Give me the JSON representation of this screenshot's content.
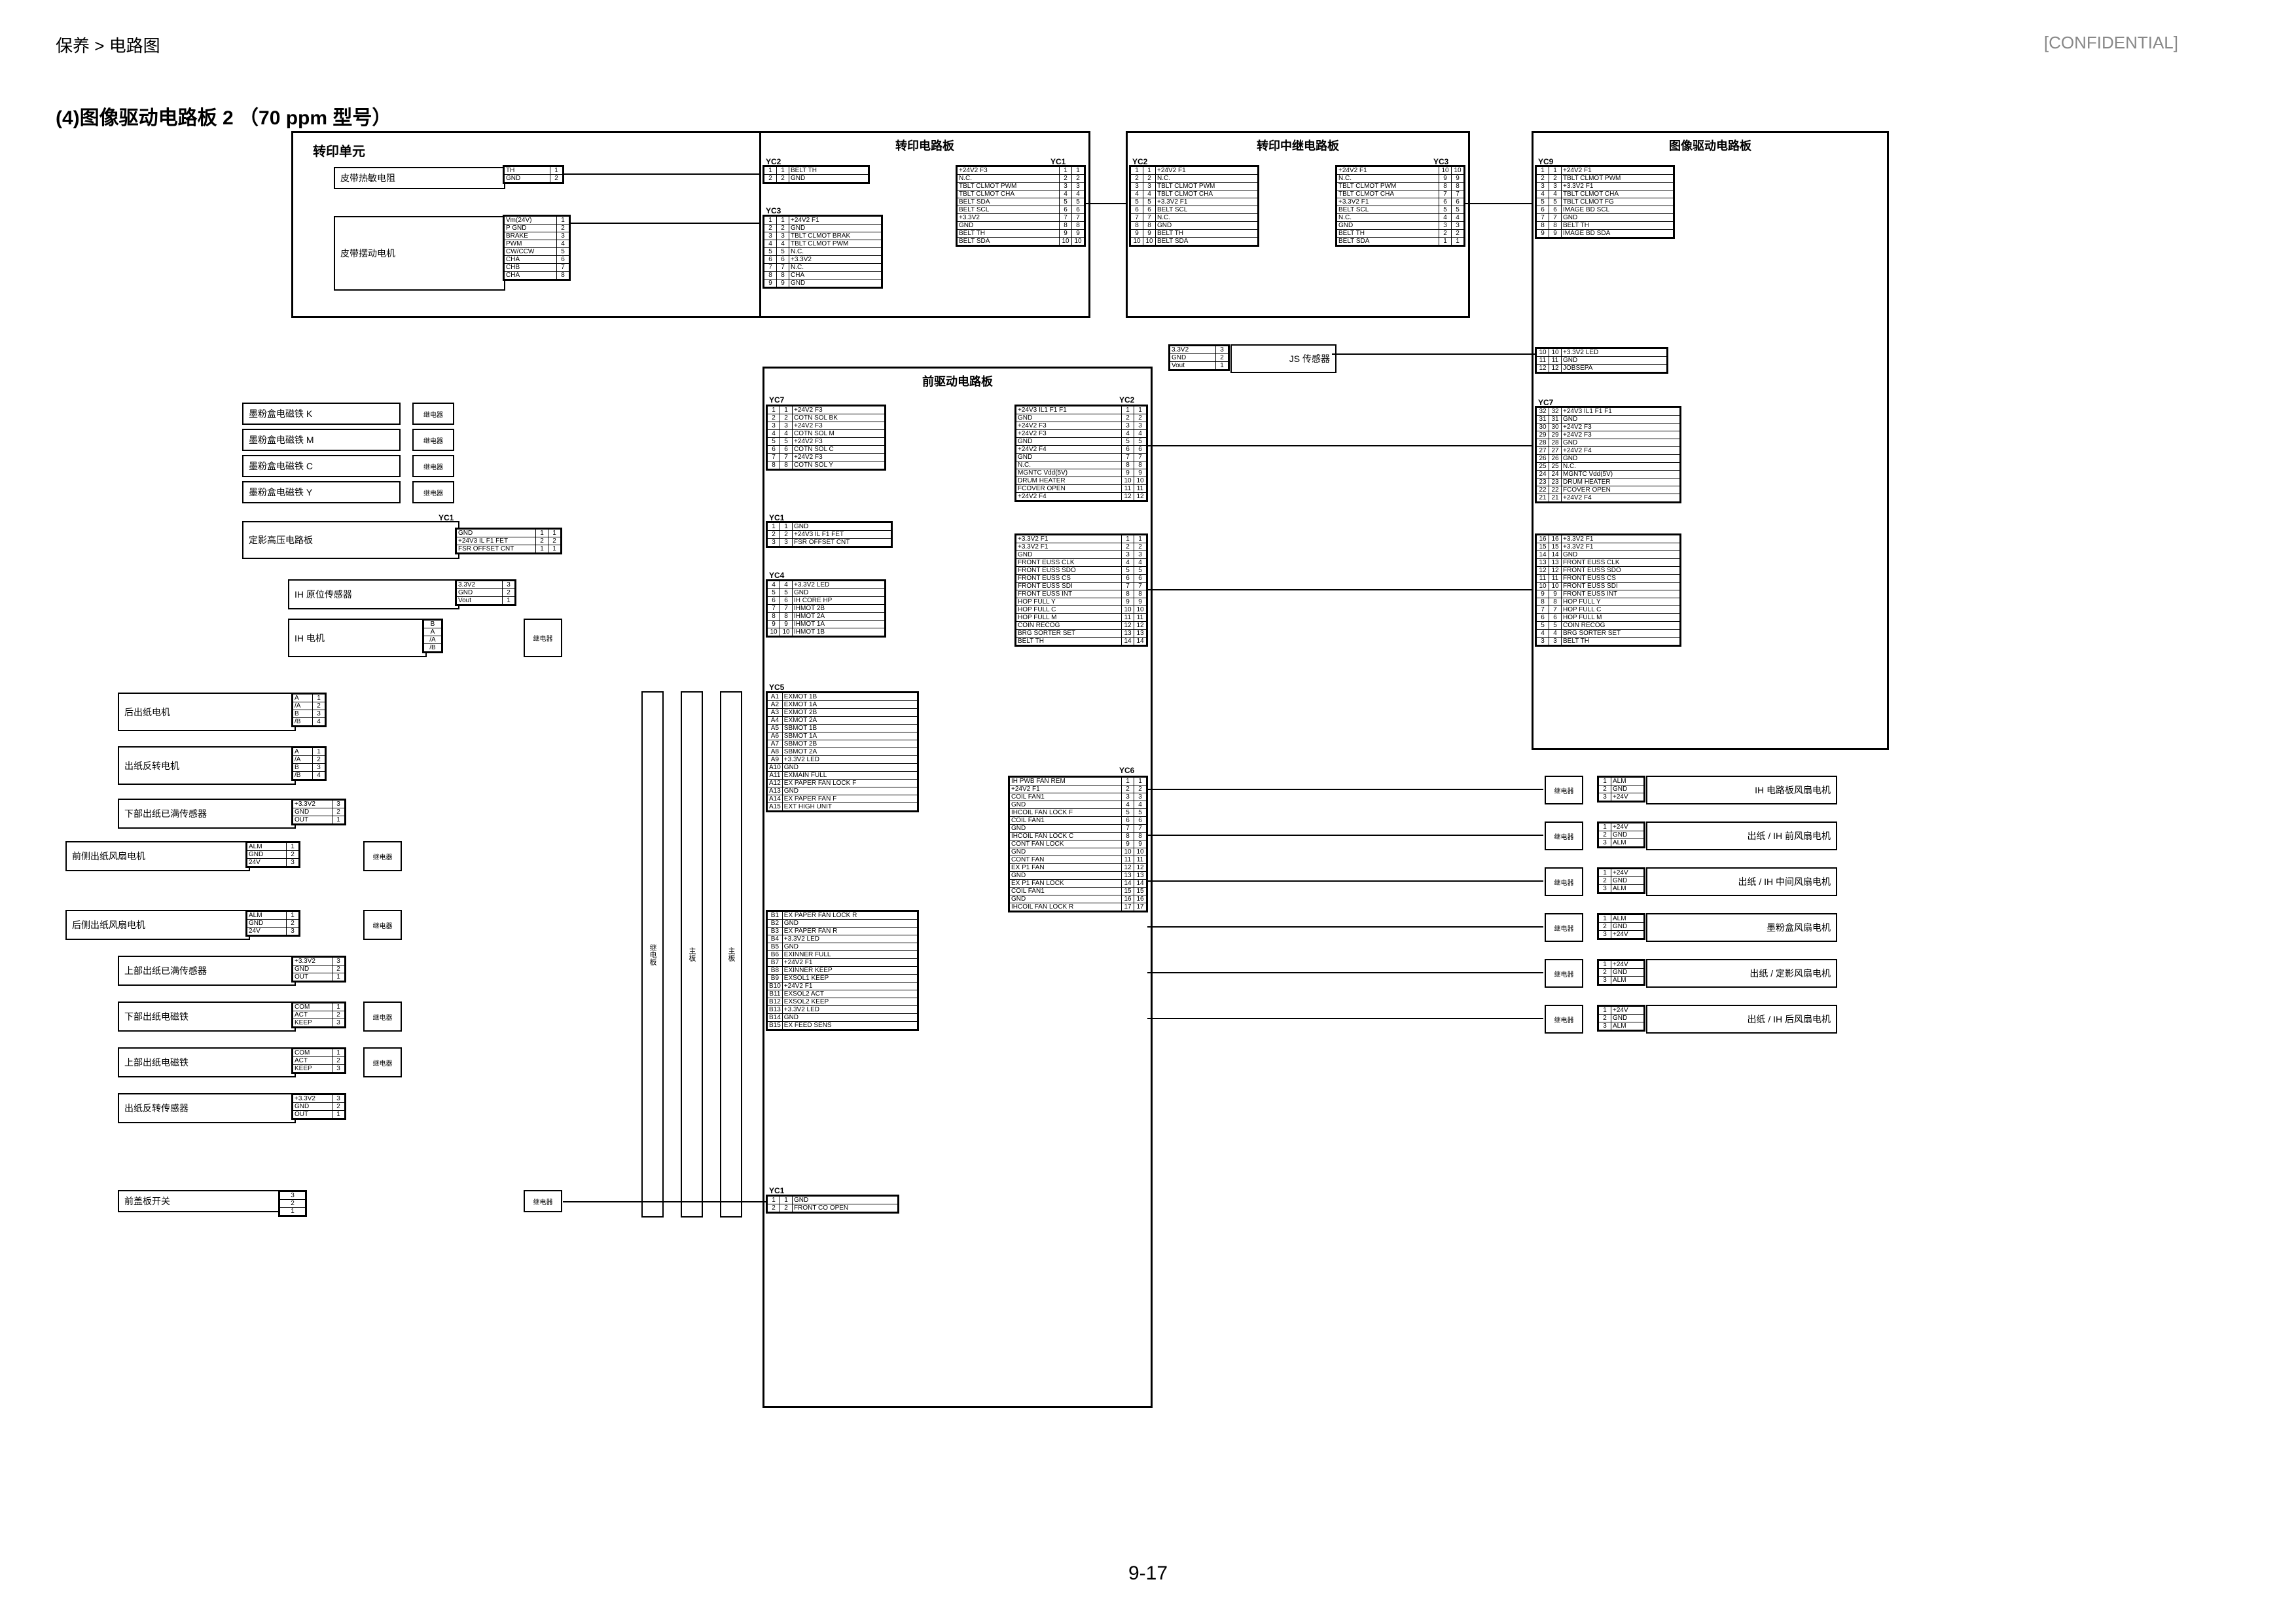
{
  "header": {
    "breadcrumb": "保养 > 电路图",
    "confidential": "[CONFIDENTIAL]"
  },
  "title": "(4)图像驱动电路板 2 （70 ppm 型号）",
  "page_number": "9-17",
  "units": {
    "transfer_unit": {
      "title": "转印单元"
    }
  },
  "pwbs": {
    "transfer": {
      "title": "转印电路板"
    },
    "transfer_relay": {
      "title": "转印中继电路板"
    },
    "engine": {
      "title": "图像驱动电路板"
    },
    "front_drive": {
      "title": "前驱动电路板"
    }
  },
  "components_left": [
    {
      "id": "belt-therm",
      "label": "皮带热敏电阻"
    },
    {
      "id": "belt-motor",
      "label": "皮带摆动电机"
    },
    {
      "id": "sol-k",
      "label": "墨粉盒电磁铁 K"
    },
    {
      "id": "sol-m",
      "label": "墨粉盒电磁铁 M"
    },
    {
      "id": "sol-c",
      "label": "墨粉盒电磁铁 C"
    },
    {
      "id": "sol-y",
      "label": "墨粉盒电磁铁 Y"
    },
    {
      "id": "fuser-hv-pwb",
      "label": "定影高压电路板"
    },
    {
      "id": "ih-hp-sens",
      "label": "IH 原位传感器"
    },
    {
      "id": "ih-motor",
      "label": "IH 电机"
    },
    {
      "id": "rear-exit",
      "label": "后出纸电机"
    },
    {
      "id": "exit-rev",
      "label": "出纸反转电机"
    },
    {
      "id": "lower-full",
      "label": "下部出纸已满传感器"
    },
    {
      "id": "front-fan",
      "label": "前侧出纸风扇电机"
    },
    {
      "id": "rear-fan",
      "label": "后侧出纸风扇电机"
    },
    {
      "id": "upper-full",
      "label": "上部出纸已满传感器"
    },
    {
      "id": "lower-sol",
      "label": "下部出纸电磁铁"
    },
    {
      "id": "upper-sol",
      "label": "上部出纸电磁铁"
    },
    {
      "id": "exit-rev-s",
      "label": "出纸反转传感器"
    },
    {
      "id": "front-sw",
      "label": "前盖板开关"
    }
  ],
  "components_right": [
    {
      "id": "js-sensor",
      "label": "JS 传感器"
    },
    {
      "id": "ih-pwb-fan",
      "label": "IH 电路板风扇电机"
    },
    {
      "id": "exit-ih-f",
      "label": "出纸 / IH 前风扇电机"
    },
    {
      "id": "exit-ih-m",
      "label": "出纸 / IH 中间风扇电机"
    },
    {
      "id": "toner-fan",
      "label": "墨粉盒风扇电机"
    },
    {
      "id": "exit-fus-fan",
      "label": "出纸 / 定影风扇电机"
    },
    {
      "id": "exit-ih-r",
      "label": "出纸 / IH 后风扇电机"
    }
  ],
  "relays": {
    "small": "继电器",
    "relay_b": "继电板",
    "main": "主板"
  },
  "pins_belt_therm": [
    {
      "n": "1",
      "sig": "TH"
    },
    {
      "n": "2",
      "sig": "GND"
    }
  ],
  "pins_belt_motor": [
    {
      "n": "1",
      "sig": "Vm(24V)"
    },
    {
      "n": "2",
      "sig": "P GND"
    },
    {
      "n": "3",
      "sig": "BRAKE"
    },
    {
      "n": "4",
      "sig": "PWM"
    },
    {
      "n": "5",
      "sig": "CW/CCW"
    },
    {
      "n": "6",
      "sig": "CHA"
    },
    {
      "n": "7",
      "sig": "CHB"
    },
    {
      "n": "8",
      "sig": "CHA"
    }
  ],
  "pins_yc2": [
    {
      "n": "1",
      "sig": "BELT TH"
    },
    {
      "n": "2",
      "sig": "GND"
    }
  ],
  "pins_yc3": [
    {
      "n": "1",
      "sig": "+24V2  F1"
    },
    {
      "n": "2",
      "sig": "GND"
    },
    {
      "n": "3",
      "sig": "TBLT CLMOT BRAK"
    },
    {
      "n": "4",
      "sig": "TBLT CLMOT PWM"
    },
    {
      "n": "5",
      "sig": "N.C."
    },
    {
      "n": "6",
      "sig": "+3.3V2"
    },
    {
      "n": "7",
      "sig": "N.C."
    },
    {
      "n": "8",
      "sig": "CHA"
    },
    {
      "n": "9",
      "sig": "GND"
    }
  ],
  "pins_yc1_transfer": [
    {
      "n": "1",
      "sig": "+24V2  F3"
    },
    {
      "n": "2",
      "sig": "N.C."
    },
    {
      "n": "3",
      "sig": "TBLT CLMOT PWM"
    },
    {
      "n": "4",
      "sig": "TBLT CLMOT CHA"
    },
    {
      "n": "5",
      "sig": "BELT SDA"
    },
    {
      "n": "6",
      "sig": "BELT SCL"
    },
    {
      "n": "7",
      "sig": "+3.3V2"
    },
    {
      "n": "8",
      "sig": "GND"
    },
    {
      "n": "9",
      "sig": "BELT TH"
    },
    {
      "n": "10",
      "sig": "BELT SDA"
    }
  ],
  "pins_yc2_relay": [
    {
      "n": "1",
      "sig": "+24V2  F1"
    },
    {
      "n": "2",
      "sig": "N.C."
    },
    {
      "n": "3",
      "sig": "TBLT CLMOT PWM"
    },
    {
      "n": "4",
      "sig": "TBLT CLMOT CHA"
    },
    {
      "n": "5",
      "sig": "+3.3V2  F1"
    },
    {
      "n": "6",
      "sig": "BELT SCL"
    },
    {
      "n": "7",
      "sig": "N.C."
    },
    {
      "n": "8",
      "sig": "GND"
    },
    {
      "n": "9",
      "sig": "BELT TH"
    },
    {
      "n": "10",
      "sig": "BELT SDA"
    }
  ],
  "pins_yc3_relay": [
    {
      "n": "10",
      "sig": "+24V2  F1"
    },
    {
      "n": "9",
      "sig": "N.C."
    },
    {
      "n": "8",
      "sig": "TBLT CLMOT PWM"
    },
    {
      "n": "7",
      "sig": "TBLT CLMOT CHA"
    },
    {
      "n": "6",
      "sig": "+3.3V2  F1"
    },
    {
      "n": "5",
      "sig": "BELT SCL"
    },
    {
      "n": "4",
      "sig": "N.C."
    },
    {
      "n": "3",
      "sig": "GND"
    },
    {
      "n": "2",
      "sig": "BELT TH"
    },
    {
      "n": "1",
      "sig": "BELT SDA"
    }
  ],
  "pins_yc9_engine": [
    {
      "n": "1",
      "sig": "+24V2  F1"
    },
    {
      "n": "2",
      "sig": "TBLT CLMOT PWM"
    },
    {
      "n": "3",
      "sig": "+3.3V2  F1"
    },
    {
      "n": "4",
      "sig": "TBLT CLMOT CHA"
    },
    {
      "n": "5",
      "sig": "TBLT CLMOT FG"
    },
    {
      "n": "6",
      "sig": "IMAGE BD SCL"
    },
    {
      "n": "7",
      "sig": "GND"
    },
    {
      "n": "8",
      "sig": "BELT TH"
    },
    {
      "n": "9",
      "sig": "IMAGE BD SDA"
    }
  ],
  "pins_js": [
    {
      "n": "3",
      "sig": "3.3V2"
    },
    {
      "n": "2",
      "sig": "GND"
    },
    {
      "n": "1",
      "sig": "Vout"
    }
  ],
  "pins_engine_js": [
    {
      "n": "10",
      "sig": "+3.3V2 LED"
    },
    {
      "n": "11",
      "sig": "GND"
    },
    {
      "n": "12",
      "sig": "JOBSEPA"
    }
  ],
  "pins_yc7_fd": [
    {
      "n": "1",
      "sig": "+24V2  F3"
    },
    {
      "n": "2",
      "sig": "COTN SOL BK"
    },
    {
      "n": "3",
      "sig": "+24V2  F3"
    },
    {
      "n": "4",
      "sig": "COTN SOL M"
    },
    {
      "n": "5",
      "sig": "+24V2  F3"
    },
    {
      "n": "6",
      "sig": "COTN SOL C"
    },
    {
      "n": "7",
      "sig": "+24V2  F3"
    },
    {
      "n": "8",
      "sig": "COTN SOL Y"
    }
  ],
  "pins_yc2_fd": [
    {
      "n": "1",
      "sig": "+24V3 IL1 F1 F1"
    },
    {
      "n": "2",
      "sig": "GND"
    },
    {
      "n": "3",
      "sig": "+24V2  F3"
    },
    {
      "n": "4",
      "sig": "+24V2  F3"
    },
    {
      "n": "5",
      "sig": "GND"
    },
    {
      "n": "6",
      "sig": "+24V2  F4"
    },
    {
      "n": "7",
      "sig": "GND"
    },
    {
      "n": "8",
      "sig": "N.C."
    },
    {
      "n": "9",
      "sig": "MGNTC Vdd(5V)"
    },
    {
      "n": "10",
      "sig": "DRUM HEATER"
    },
    {
      "n": "11",
      "sig": "FCOVER OPEN"
    },
    {
      "n": "12",
      "sig": "+24V2  F4"
    }
  ],
  "pins_yc7_engine": [
    {
      "n": "32",
      "sig": "+24V3 IL1 F1 F1"
    },
    {
      "n": "31",
      "sig": "GND"
    },
    {
      "n": "30",
      "sig": "+24V2  F3"
    },
    {
      "n": "29",
      "sig": "+24V2  F3"
    },
    {
      "n": "28",
      "sig": "GND"
    },
    {
      "n": "27",
      "sig": "+24V2  F4"
    },
    {
      "n": "26",
      "sig": "GND"
    },
    {
      "n": "25",
      "sig": "N.C."
    },
    {
      "n": "24",
      "sig": "MGNTC Vdd(5V)"
    },
    {
      "n": "23",
      "sig": "DRUM HEATER"
    },
    {
      "n": "22",
      "sig": "FCOVER OPEN"
    },
    {
      "n": "21",
      "sig": "+24V2  F4"
    }
  ],
  "pins_yc3_fd": [
    {
      "n": "1",
      "sig": "+3.3V2  F1"
    },
    {
      "n": "2",
      "sig": "+3.3V2  F1"
    },
    {
      "n": "3",
      "sig": "GND"
    },
    {
      "n": "4",
      "sig": "FRONT EUSS CLK"
    },
    {
      "n": "5",
      "sig": "FRONT EUSS SDO"
    },
    {
      "n": "6",
      "sig": "FRONT EUSS CS"
    },
    {
      "n": "7",
      "sig": "FRONT EUSS SDI"
    },
    {
      "n": "8",
      "sig": "FRONT EUSS INT"
    },
    {
      "n": "9",
      "sig": "HOP FULL Y"
    },
    {
      "n": "10",
      "sig": "HOP FULL C"
    },
    {
      "n": "11",
      "sig": "HOP FULL M"
    },
    {
      "n": "12",
      "sig": "COIN RECOG"
    },
    {
      "n": "13",
      "sig": "BRG SORTER SET"
    },
    {
      "n": "14",
      "sig": "BELT TH"
    }
  ],
  "pins_yc7b_engine": [
    {
      "n": "16",
      "sig": "+3.3V2  F1"
    },
    {
      "n": "15",
      "sig": "+3.3V2  F1"
    },
    {
      "n": "14",
      "sig": "GND"
    },
    {
      "n": "13",
      "sig": "FRONT EUSS CLK"
    },
    {
      "n": "12",
      "sig": "FRONT EUSS SDO"
    },
    {
      "n": "11",
      "sig": "FRONT EUSS CS"
    },
    {
      "n": "10",
      "sig": "FRONT EUSS SDI"
    },
    {
      "n": "9",
      "sig": "FRONT EUSS INT"
    },
    {
      "n": "8",
      "sig": "HOP FULL Y"
    },
    {
      "n": "7",
      "sig": "HOP FULL C"
    },
    {
      "n": "6",
      "sig": "HOP FULL M"
    },
    {
      "n": "5",
      "sig": "COIN RECOG"
    },
    {
      "n": "4",
      "sig": "BRG SORTER SET"
    },
    {
      "n": "3",
      "sig": "BELT TH"
    }
  ],
  "pins_yc1_fd": [
    {
      "n": "1",
      "sig": "GND"
    },
    {
      "n": "2",
      "sig": "+24V3 IL F1 FET"
    },
    {
      "n": "3",
      "sig": "FSR OFFSET CNT"
    }
  ],
  "pins_fuser_hv": [
    {
      "n": "1",
      "sig": "GND"
    },
    {
      "n": "2",
      "sig": "+24V3 IL F1 FET"
    },
    {
      "n": "1",
      "sig": "FSR OFFSET CNT"
    }
  ],
  "pins_ih_hp": [
    {
      "n": "3",
      "sig": "3.3V2"
    },
    {
      "n": "2",
      "sig": "GND"
    },
    {
      "n": "1",
      "sig": "Vout"
    }
  ],
  "pins_yc4_fd": [
    {
      "n": "4",
      "sig": "+3.3V2 LED"
    },
    {
      "n": "5",
      "sig": "GND"
    },
    {
      "n": "6",
      "sig": "IH CORE HP"
    },
    {
      "n": "7",
      "sig": "IHMOT 2B"
    },
    {
      "n": "8",
      "sig": "IHMOT 2A"
    },
    {
      "n": "9",
      "sig": "IHMOT 1A"
    },
    {
      "n": "10",
      "sig": "IHMOT 1B"
    }
  ],
  "pins_ih_mot": [
    {
      "n": "B"
    },
    {
      "n": "A"
    },
    {
      "n": "/A"
    },
    {
      "n": "/B"
    }
  ],
  "pins_yc5_a": [
    {
      "n": "A1",
      "sig": "EXMOT 1B"
    },
    {
      "n": "A2",
      "sig": "EXMOT 1A"
    },
    {
      "n": "A3",
      "sig": "EXMOT 2B"
    },
    {
      "n": "A4",
      "sig": "EXMOT 2A"
    },
    {
      "n": "A5",
      "sig": "SBMOT 1B"
    },
    {
      "n": "A6",
      "sig": "SBMOT 1A"
    },
    {
      "n": "A7",
      "sig": "SBMOT 2B"
    },
    {
      "n": "A8",
      "sig": "SBMOT 2A"
    },
    {
      "n": "A9",
      "sig": "+3.3V2 LED"
    },
    {
      "n": "A10",
      "sig": "GND"
    },
    {
      "n": "A11",
      "sig": "EXMAIN FULL"
    },
    {
      "n": "A12",
      "sig": "EX PAPER FAN LOCK F"
    },
    {
      "n": "A13",
      "sig": "GND"
    },
    {
      "n": "A14",
      "sig": "EX PAPER FAN F"
    },
    {
      "n": "A15",
      "sig": "EXT HIGH UNIT"
    }
  ],
  "pins_yc5_b": [
    {
      "n": "B1",
      "sig": "EX PAPER FAN LOCK R"
    },
    {
      "n": "B2",
      "sig": "GND"
    },
    {
      "n": "B3",
      "sig": "EX PAPER FAN R"
    },
    {
      "n": "B4",
      "sig": "+3.3V2 LED"
    },
    {
      "n": "B5",
      "sig": "GND"
    },
    {
      "n": "B6",
      "sig": "EXINNER FULL"
    },
    {
      "n": "B7",
      "sig": "+24V2  F1"
    },
    {
      "n": "B8",
      "sig": "EXINNER KEEP"
    },
    {
      "n": "B9",
      "sig": "EXSOL1 KEEP"
    },
    {
      "n": "B10",
      "sig": "+24V2  F1"
    },
    {
      "n": "B11",
      "sig": "EXSOL2 ACT"
    },
    {
      "n": "B12",
      "sig": "EXSOL2 KEEP"
    },
    {
      "n": "B13",
      "sig": "+3.3V2 LED"
    },
    {
      "n": "B14",
      "sig": "GND"
    },
    {
      "n": "B15",
      "sig": "EX FEED SENS"
    }
  ],
  "pins_yc6_fd": [
    {
      "n": "1",
      "sig": "IH PWB FAN REM"
    },
    {
      "n": "2",
      "sig": "+24V2  F1"
    },
    {
      "n": "3",
      "sig": "COIL FAN1"
    },
    {
      "n": "4",
      "sig": "GND"
    },
    {
      "n": "5",
      "sig": "IHCOIL FAN LOCK F"
    },
    {
      "n": "6",
      "sig": "COIL FAN1"
    },
    {
      "n": "7",
      "sig": "GND"
    },
    {
      "n": "8",
      "sig": "IHCOIL FAN LOCK C"
    },
    {
      "n": "9",
      "sig": "CONT FAN LOCK"
    },
    {
      "n": "10",
      "sig": "GND"
    },
    {
      "n": "11",
      "sig": "CONT FAN"
    },
    {
      "n": "12",
      "sig": "EX P1 FAN"
    },
    {
      "n": "13",
      "sig": "GND"
    },
    {
      "n": "14",
      "sig": "EX P1 FAN LOCK"
    },
    {
      "n": "15",
      "sig": "COIL FAN1"
    },
    {
      "n": "16",
      "sig": "GND"
    },
    {
      "n": "17",
      "sig": "IHCOIL FAN LOCK R"
    }
  ],
  "pins_fan3": [
    {
      "n": "1",
      "sig": "ALM"
    },
    {
      "n": "2",
      "sig": "GND"
    },
    {
      "n": "3",
      "sig": "+24V"
    }
  ],
  "pins_fan3_alt": [
    {
      "n": "1",
      "sig": "+24V"
    },
    {
      "n": "2",
      "sig": "GND"
    },
    {
      "n": "3",
      "sig": "ALM"
    }
  ],
  "pins_rear_exit": [
    {
      "n": "1",
      "sig": "A"
    },
    {
      "n": "2",
      "sig": "/A"
    },
    {
      "n": "3",
      "sig": "B"
    },
    {
      "n": "4",
      "sig": "/B"
    }
  ],
  "pins_sens3": [
    {
      "n": "3",
      "sig": "+3.3V2"
    },
    {
      "n": "2",
      "sig": "GND"
    },
    {
      "n": "1",
      "sig": "OUT"
    }
  ],
  "pins_fan_lr": [
    {
      "n": "1",
      "sig": "ALM"
    },
    {
      "n": "2",
      "sig": "GND"
    },
    {
      "n": "3",
      "sig": "24V"
    }
  ],
  "pins_sol": [
    {
      "n": "1",
      "sig": "COM"
    },
    {
      "n": "2",
      "sig": "ACT"
    },
    {
      "n": "3",
      "sig": "KEEP"
    }
  ],
  "pins_front_sw": [
    {
      "n": "3"
    },
    {
      "n": "2"
    },
    {
      "n": "1"
    }
  ],
  "pins_yc1_sw": [
    {
      "n": "1",
      "sig": "GND"
    },
    {
      "n": "2",
      "sig": "FRONT CO OPEN"
    }
  ],
  "conn_labels": {
    "yc1": "YC1",
    "yc2": "YC2",
    "yc3": "YC3",
    "yc4": "YC4",
    "yc5": "YC5",
    "yc6": "YC6",
    "yc7": "YC7",
    "yc9": "YC9"
  }
}
